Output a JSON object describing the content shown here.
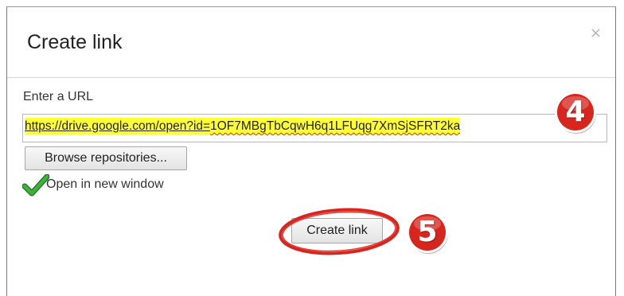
{
  "dialog": {
    "title": "Create link",
    "close_label": "×",
    "url_label": "Enter a URL",
    "url_value_prefix": "https://drive.google.com/open?id=",
    "url_value_id": "1OF7MBgTbCqwH6q1LFUqg7XmSjSFRT2ka",
    "browse_label": "Browse repositories...",
    "new_window_label": "Open in new window",
    "new_window_checked": true,
    "create_label": "Create link"
  },
  "annotations": {
    "step_4": "4",
    "step_5": "5",
    "badge_color": "#d7261e",
    "ellipse_color": "#d7261e",
    "highlight_color": "#ffff33",
    "check_color": "#2e9b2e"
  }
}
